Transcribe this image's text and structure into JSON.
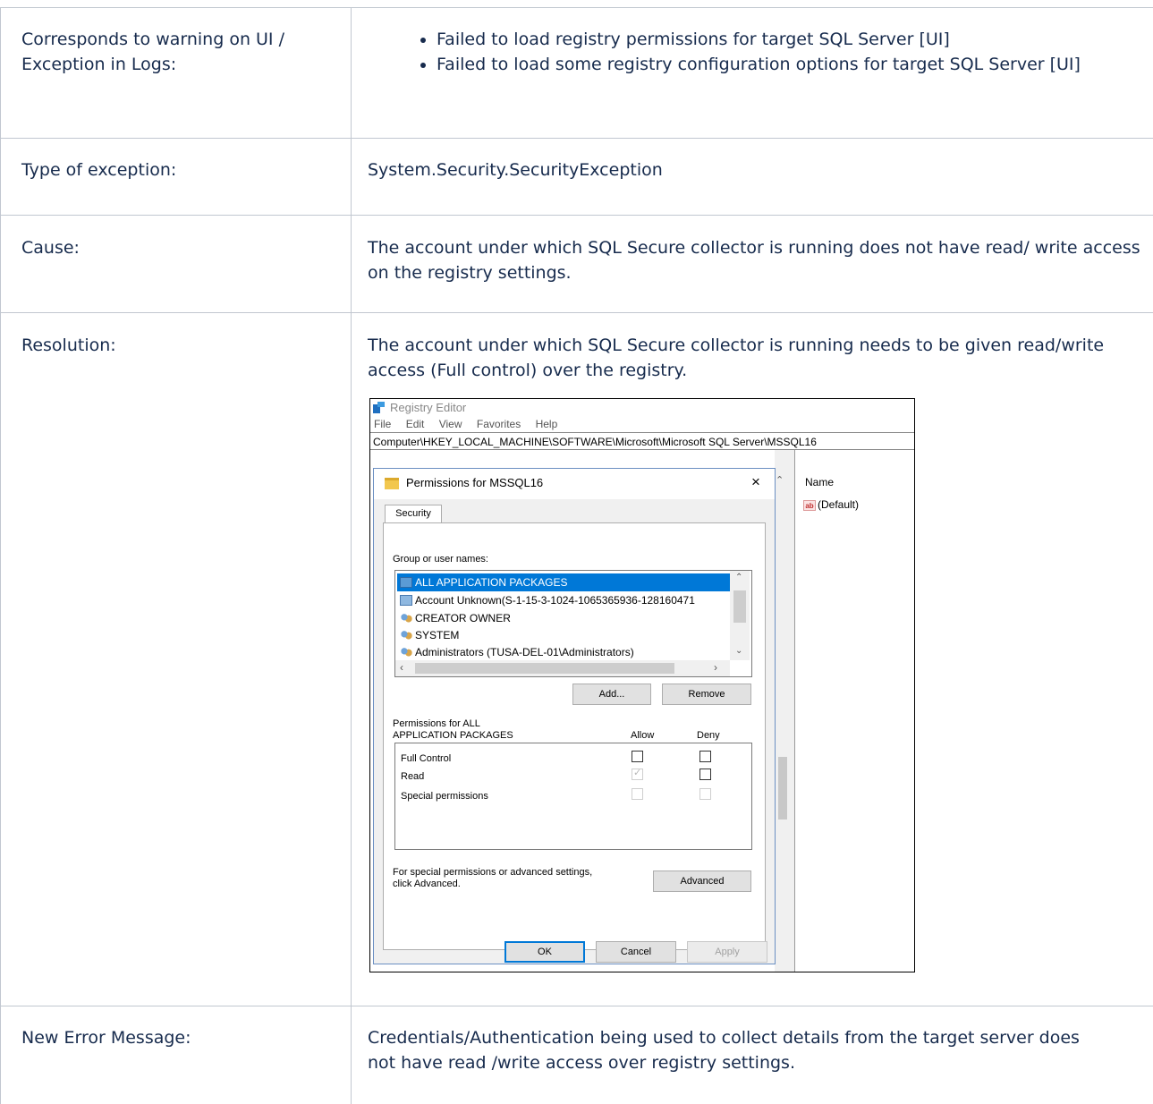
{
  "rows": {
    "warning": {
      "label": "Corresponds to warning on UI / Exception in Logs:",
      "items": [
        "Failed to load registry permissions for target SQL Server [UI]",
        "Failed to load some registry configuration options for target SQL Server [UI]"
      ]
    },
    "exception": {
      "label": "Type of exception:",
      "value": "System.Security.SecurityException"
    },
    "cause": {
      "label": "Cause:",
      "value": "The account under which SQL Secure collector is running does not have read/ write access on the registry settings."
    },
    "resolution": {
      "label": "Resolution:",
      "value": "The account under which SQL Secure collector is running needs to be given read/write access (Full control) over the registry."
    },
    "new_error": {
      "label": "New Error Message:",
      "value": "Credentials/Authentication being used to collect details from the target server does not have read /write access over registry settings."
    }
  },
  "screenshot": {
    "window_title": "Registry Editor",
    "menu": [
      "File",
      "Edit",
      "View",
      "Favorites",
      "Help"
    ],
    "address": "Computer\\HKEY_LOCAL_MACHINE\\SOFTWARE\\Microsoft\\Microsoft SQL Server\\MSSQL16",
    "values_header": "Name",
    "default_value": "(Default)",
    "default_icon_text": "ab",
    "dialog": {
      "title": "Permissions for MSSQL16",
      "close": "×",
      "tab": "Security",
      "group_label": "Group or user names:",
      "users": [
        "ALL APPLICATION PACKAGES",
        "Account Unknown(S-1-15-3-1024-1065365936-128160471",
        "CREATOR OWNER",
        "SYSTEM",
        "Administrators (TUSA-DEL-01\\Administrators)"
      ],
      "add_button": "Add...",
      "remove_button": "Remove",
      "permissions_label_line1": "Permissions for ALL",
      "permissions_label_line2": "APPLICATION PACKAGES",
      "allow_header": "Allow",
      "deny_header": "Deny",
      "permissions": [
        {
          "name": "Full Control",
          "allow": false,
          "deny": false,
          "enabled": true
        },
        {
          "name": "Read",
          "allow": true,
          "deny": false,
          "enabled": true
        },
        {
          "name": "Special permissions",
          "allow": false,
          "deny": false,
          "enabled": false
        }
      ],
      "advanced_text_line1": "For special permissions or advanced settings,",
      "advanced_text_line2": "click Advanced.",
      "advanced_button": "Advanced",
      "ok_button": "OK",
      "cancel_button": "Cancel",
      "apply_button": "Apply"
    }
  }
}
